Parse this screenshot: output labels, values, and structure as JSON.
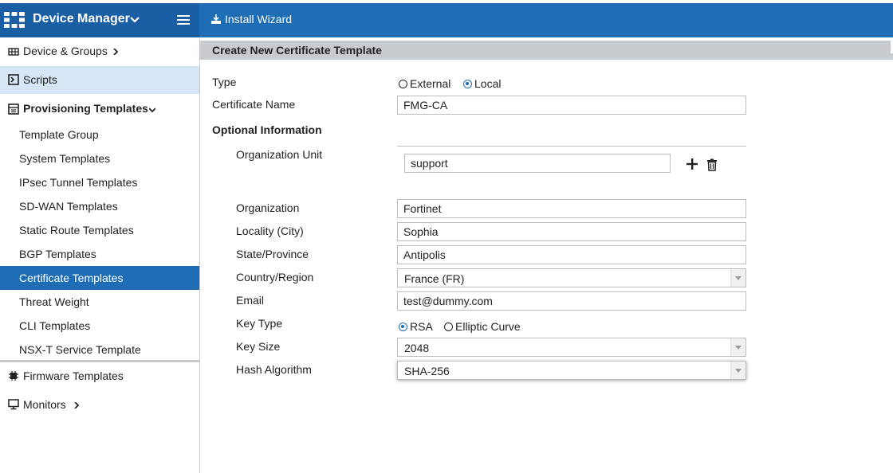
{
  "topbar": {
    "app_title": "Device Manager",
    "install_wizard_label": "Install Wizard",
    "brand_color": "#1f6db5"
  },
  "sidebar": {
    "device_groups": "Device & Groups",
    "scripts": "Scripts",
    "provisioning_templates": "Provisioning Templates",
    "sub_items": [
      "Template Group",
      "System Templates",
      "IPsec Tunnel Templates",
      "SD-WAN Templates",
      "Static Route Templates",
      "BGP Templates",
      "Certificate Templates",
      "Threat Weight",
      "CLI Templates",
      "NSX-T Service Template"
    ],
    "active_item": "Certificate Templates",
    "firmware_templates": "Firmware Templates",
    "monitors": "Monitors"
  },
  "form": {
    "header": "Create New Certificate Template",
    "type_label": "Type",
    "type_external": "External",
    "type_local": "Local",
    "type_selected": "Local",
    "cert_name_label": "Certificate Name",
    "cert_name_value": "FMG-CA",
    "optional_info": "Optional Information",
    "org_unit_label": "Organization Unit",
    "org_unit_value": "support",
    "organization_label": "Organization",
    "organization_value": "Fortinet",
    "locality_label": "Locality (City)",
    "locality_value": "Sophia",
    "state_label": "State/Province",
    "state_value": "Antipolis",
    "country_label": "Country/Region",
    "country_value": "France (FR)",
    "email_label": "Email",
    "email_value": "test@dummy.com",
    "key_type_label": "Key Type",
    "key_type_rsa": "RSA",
    "key_type_ec": "Elliptic Curve",
    "key_type_selected": "RSA",
    "key_size_label": "Key Size",
    "key_size_value": "2048",
    "hash_label": "Hash Algorithm",
    "hash_value": "SHA-256"
  }
}
